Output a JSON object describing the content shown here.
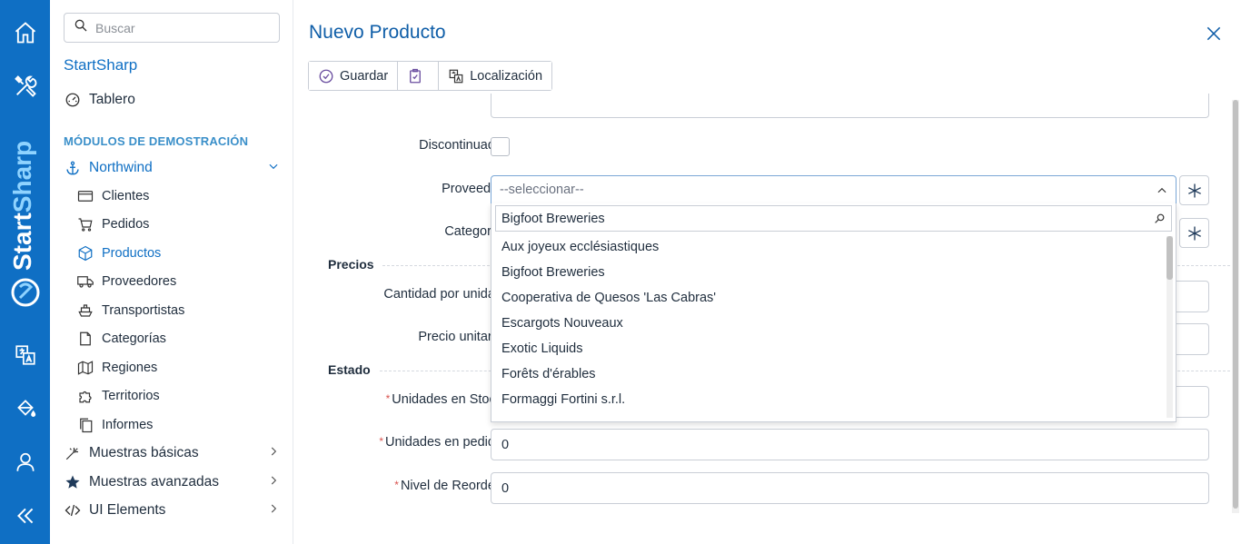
{
  "rail": {
    "brand": "StartSharp",
    "icons": [
      "home-icon",
      "tools-icon",
      "translate-icon",
      "paint-bucket-icon",
      "user-icon",
      "collapse-icon"
    ]
  },
  "sidebar": {
    "search_placeholder": "Buscar",
    "app_title": "StartSharp",
    "dashboard": "Tablero",
    "section": "MÓDULOS DE DEMOSTRACIÓN",
    "northwind": "Northwind",
    "sub_items": [
      "Clientes",
      "Pedidos",
      "Productos",
      "Proveedores",
      "Transportistas",
      "Categorías",
      "Regiones",
      "Territorios",
      "Informes"
    ],
    "groups": [
      "Muestras básicas",
      "Muestras avanzadas",
      "UI Elements"
    ]
  },
  "dialog": {
    "title": "Nuevo Producto",
    "toolbar": {
      "save": "Guardar",
      "localization": "Localización"
    },
    "fields": {
      "discontinued": "Discontinuado",
      "supplier": "Proveedor",
      "category": "Categoría",
      "prices_section": "Precios",
      "quantity_per_unit": "Cantidad por unidad",
      "unit_price": "Precio unitario",
      "status_section": "Estado",
      "units_in_stock": "Unidades en Stock",
      "units_on_order": "Unidades en pedido",
      "reorder_level": "Nivel de Reorden"
    },
    "values": {
      "units_on_order": "0",
      "reorder_level": "0"
    },
    "supplier_select": {
      "placeholder": "--seleccionar--",
      "search_text": "Bigfoot Breweries",
      "options": [
        "Aux joyeux ecclésiastiques",
        "Bigfoot Breweries",
        "Cooperativa de Quesos 'Las Cabras'",
        "Escargots Nouveaux",
        "Exotic Liquids",
        "Forêts d'érables",
        "Formaggi Fortini s.r.l."
      ]
    },
    "accent_color": "#0f6fc4"
  }
}
